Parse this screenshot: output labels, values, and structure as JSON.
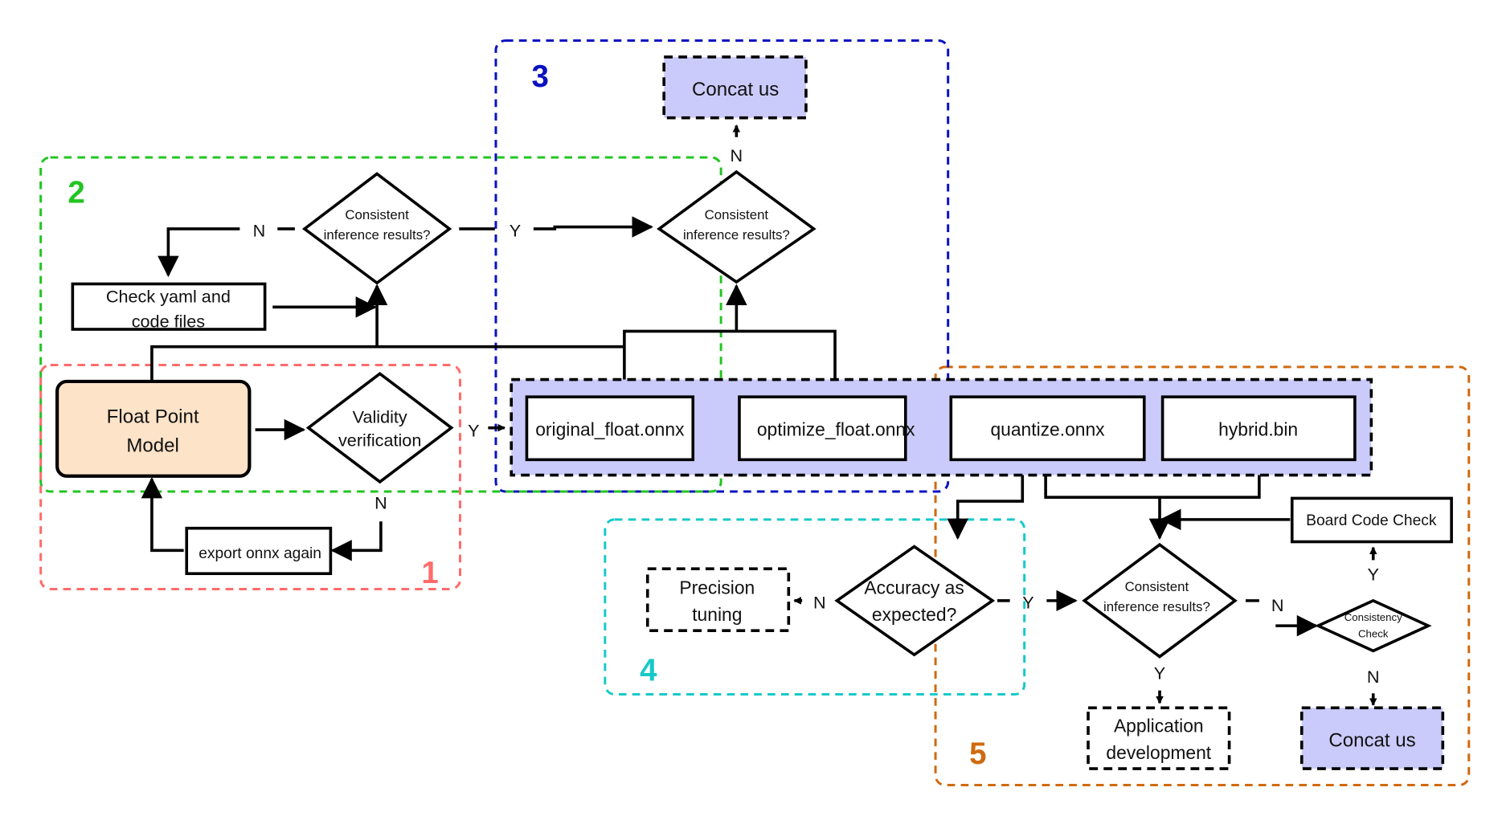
{
  "colors": {
    "group1": "#ff6b6b",
    "group2": "#22c522",
    "group3": "#0a12c0",
    "group4": "#17c9c9",
    "group5": "#d06a10",
    "model_fill": "#fde3c8",
    "file_panel_fill": "#cbcbfb",
    "contact_fill": "#cbcbfb"
  },
  "groups": [
    {
      "id": "1",
      "label": "1"
    },
    {
      "id": "2",
      "label": "2"
    },
    {
      "id": "3",
      "label": "3"
    },
    {
      "id": "4",
      "label": "4"
    },
    {
      "id": "5",
      "label": "5"
    }
  ],
  "nodes": {
    "float_model": {
      "line1": "Float Point",
      "line2": "Model"
    },
    "validity": {
      "line1": "Validity",
      "line2": "verification"
    },
    "export_again": {
      "label": "export onnx again"
    },
    "check_yaml": {
      "line1": "Check yaml and",
      "line2": "code files"
    },
    "consistent_2": {
      "line1": "Consistent",
      "line2": "inference results?"
    },
    "consistent_3": {
      "line1": "Consistent",
      "line2": "inference results?"
    },
    "contact_3": {
      "label": "Concat us"
    },
    "files": [
      "original_float.onnx",
      "optimize_float.onnx",
      "quantize.onnx",
      "hybrid.bin"
    ],
    "accuracy": {
      "line1": "Accuracy as",
      "line2": "expected?"
    },
    "precision": {
      "line1": "Precision",
      "line2": "tuning"
    },
    "consistent_5": {
      "line1": "Consistent",
      "line2": "inference results?"
    },
    "consistency_check": {
      "line1": "Consistency",
      "line2": "Check"
    },
    "board_check": {
      "label": "Board Code Check"
    },
    "app_dev": {
      "line1": "Application",
      "line2": "development"
    },
    "contact_5": {
      "label": "Concat us"
    }
  },
  "edge_labels": {
    "validity_yes": "Y",
    "validity_no": "N",
    "c2_no": "N",
    "c2_yes": "Y",
    "c3_no": "N",
    "accuracy_no": "N",
    "accuracy_yes": "Y",
    "c5_no": "N",
    "c5_yes": "Y",
    "cc_yes": "Y",
    "cc_no": "N"
  }
}
